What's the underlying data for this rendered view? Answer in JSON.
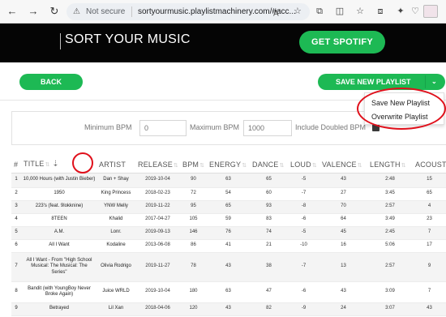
{
  "browser": {
    "secure_label": "Not secure",
    "url": "sortyourmusic.playlistmachinery.com/#acc..."
  },
  "header": {
    "title": "SORT YOUR MUSIC",
    "get_spotify": "GET SPOTIFY"
  },
  "actions": {
    "back": "BACK",
    "save_new_playlist": "SAVE NEW PLAYLIST"
  },
  "dropdown": {
    "items": [
      "Save New Playlist",
      "Overwrite Playlist"
    ]
  },
  "bpm_filter": {
    "min_label": "Minimum BPM",
    "min_placeholder": "0",
    "max_label": "Maximum BPM",
    "max_placeholder": "1000",
    "doubled_label": "Include Doubled BPM"
  },
  "table": {
    "columns": [
      "#",
      "TITLE",
      "ARTIST",
      "RELEASE",
      "BPM",
      "ENERGY",
      "DANCE",
      "LOUD",
      "VALENCE",
      "LENGTH",
      "ACOUSTIC"
    ],
    "rows": [
      [
        "1",
        "10,000 Hours (with Justin Bieber)",
        "Dan + Shay",
        "2019-10-04",
        "90",
        "63",
        "65",
        "-5",
        "43",
        "2:48",
        "15"
      ],
      [
        "2",
        "1950",
        "King Princess",
        "2018-02-23",
        "72",
        "54",
        "60",
        "-7",
        "27",
        "3:45",
        "65"
      ],
      [
        "3",
        "223's (feat. 9lokknine)",
        "YNW Melly",
        "2019-11-22",
        "95",
        "65",
        "93",
        "-8",
        "70",
        "2:57",
        "4"
      ],
      [
        "4",
        "8TEEN",
        "Khalid",
        "2017-04-27",
        "105",
        "59",
        "83",
        "-6",
        "64",
        "3:49",
        "23"
      ],
      [
        "5",
        "A.M.",
        "Lonr.",
        "2019-09-13",
        "146",
        "76",
        "74",
        "-5",
        "45",
        "2:45",
        "7"
      ],
      [
        "6",
        "All I Want",
        "Kodaline",
        "2013-06-08",
        "86",
        "41",
        "21",
        "-10",
        "16",
        "5:06",
        "17"
      ],
      [
        "7",
        "All I Want - From \"High School Musical: The Musical: The Series\"",
        "Olivia Rodrigo",
        "2019-11-27",
        "78",
        "43",
        "38",
        "-7",
        "13",
        "2:57",
        "9"
      ],
      [
        "8",
        "Bandit (with YoungBoy Never Broke Again)",
        "Juice WRLD",
        "2019-10-04",
        "180",
        "63",
        "47",
        "-6",
        "43",
        "3:09",
        "7"
      ],
      [
        "9",
        "Betrayed",
        "Lil Xan",
        "2018-04-06",
        "120",
        "43",
        "82",
        "-9",
        "24",
        "3:07",
        "43"
      ]
    ]
  },
  "colors": {
    "spotify_green": "#1db954",
    "header_bg": "#050505",
    "annotation_red": "#e0101b"
  }
}
